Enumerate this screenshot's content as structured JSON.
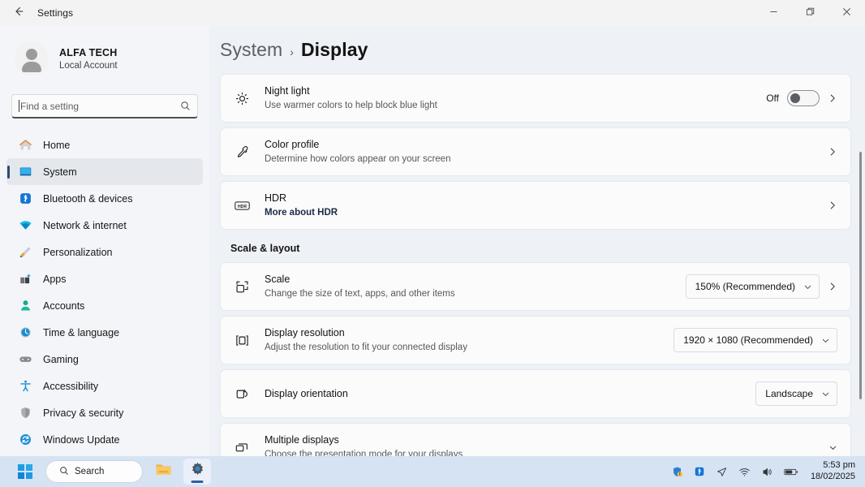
{
  "window": {
    "title": "Settings",
    "back_icon": "arrow-left-icon",
    "controls": [
      {
        "name": "minimize",
        "label": "—"
      },
      {
        "name": "maximize",
        "label": "❐"
      },
      {
        "name": "close",
        "label": "✕"
      }
    ]
  },
  "sidebar": {
    "account": {
      "name": "ALFA TECH",
      "subtitle": "Local Account",
      "avatar_icon": "user-avatar-icon"
    },
    "search": {
      "placeholder": "Find a setting",
      "icon": "search-icon"
    },
    "items": [
      {
        "label": "Home",
        "icon": "home-icon",
        "active": false
      },
      {
        "label": "System",
        "icon": "monitor-icon",
        "active": true
      },
      {
        "label": "Bluetooth & devices",
        "icon": "bluetooth-icon",
        "active": false
      },
      {
        "label": "Network & internet",
        "icon": "wifi-icon",
        "active": false
      },
      {
        "label": "Personalization",
        "icon": "paintbrush-icon",
        "active": false
      },
      {
        "label": "Apps",
        "icon": "apps-icon",
        "active": false
      },
      {
        "label": "Accounts",
        "icon": "person-icon",
        "active": false
      },
      {
        "label": "Time & language",
        "icon": "clock-icon",
        "active": false
      },
      {
        "label": "Gaming",
        "icon": "gamepad-icon",
        "active": false
      },
      {
        "label": "Accessibility",
        "icon": "accessibility-icon",
        "active": false
      },
      {
        "label": "Privacy & security",
        "icon": "shield-icon",
        "active": false
      },
      {
        "label": "Windows Update",
        "icon": "update-icon",
        "active": false
      }
    ]
  },
  "main": {
    "breadcrumb": {
      "root": "System",
      "separator": "›",
      "current": "Display"
    },
    "rows": [
      {
        "title": "Night light",
        "subtitle": "Use warmer colors to help block blue light",
        "icon": "brightness-icon",
        "control": "toggle",
        "toggle_state": "Off",
        "chevron": "chevron-right-icon"
      },
      {
        "title": "Color profile",
        "subtitle": "Determine how colors appear on your screen",
        "icon": "eyedropper-icon",
        "control": "chevron",
        "chevron": "chevron-right-icon"
      },
      {
        "title": "HDR",
        "subtitle": "More about HDR",
        "subtitle_is_link": true,
        "icon": "hdr-badge-icon",
        "control": "chevron",
        "chevron": "chevron-right-icon"
      }
    ],
    "section_title": "Scale & layout",
    "layout_rows": [
      {
        "title": "Scale",
        "subtitle": "Change the size of text, apps, and other items",
        "icon": "scale-icon",
        "control": "dropdown-chevron",
        "value": "150% (Recommended)",
        "dropdown_icon": "chevron-down-icon",
        "chevron": "chevron-right-icon"
      },
      {
        "title": "Display resolution",
        "subtitle": "Adjust the resolution to fit your connected display",
        "icon": "resolution-icon",
        "control": "dropdown",
        "value": "1920 × 1080 (Recommended)",
        "dropdown_icon": "chevron-down-icon"
      },
      {
        "title": "Display orientation",
        "subtitle": "",
        "icon": "orientation-icon",
        "control": "dropdown",
        "value": "Landscape",
        "dropdown_icon": "chevron-down-icon"
      },
      {
        "title": "Multiple displays",
        "subtitle": "Choose the presentation mode for your displays",
        "icon": "multiple-displays-icon",
        "control": "expander",
        "dropdown_icon": "chevron-down-icon"
      }
    ]
  },
  "taskbar": {
    "start_icon": "windows-start-icon",
    "search": {
      "label": "Search",
      "icon": "search-icon"
    },
    "pinned": [
      {
        "name": "file-explorer",
        "icon": "folder-icon"
      },
      {
        "name": "settings",
        "icon": "gear-icon",
        "active": true
      }
    ],
    "tray": [
      {
        "name": "security-warning",
        "icon": "shield-warning-icon"
      },
      {
        "name": "bluetooth",
        "icon": "bluetooth-icon"
      },
      {
        "name": "location",
        "icon": "location-arrow-icon"
      },
      {
        "name": "network",
        "icon": "wifi-icon"
      },
      {
        "name": "volume",
        "icon": "speaker-icon"
      },
      {
        "name": "battery",
        "icon": "battery-icon"
      }
    ],
    "clock": {
      "time": "5:53 pm",
      "date": "18/02/2025"
    }
  },
  "colors": {
    "background": "#eef1f6",
    "card": "#fbfbfc",
    "sidebar": "#f3f5f9",
    "taskbar": "#d6e3f3",
    "accent": "#2f5fa8"
  }
}
